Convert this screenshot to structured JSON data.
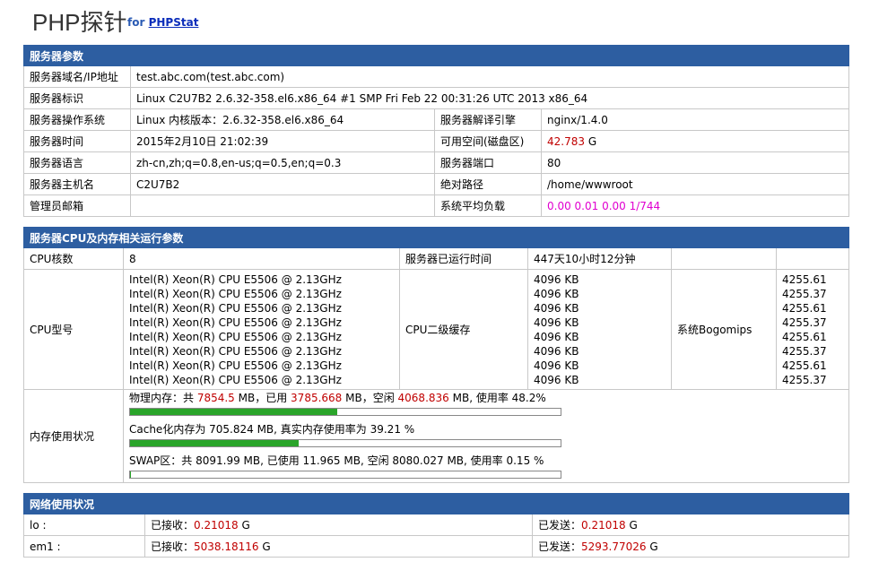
{
  "header": {
    "title": "PHP探针",
    "for_label": "for",
    "link": "PHPStat"
  },
  "server": {
    "section": "服务器参数",
    "rows": [
      {
        "label": "服务器域名/IP地址",
        "value": "test.abc.com(test.abc.com)"
      },
      {
        "label": "服务器标识",
        "value": "Linux C2U7B2 2.6.32-358.el6.x86_64 #1 SMP Fri Feb 22 00:31:26 UTC 2013 x86_64"
      },
      {
        "label": "服务器操作系统",
        "value": "Linux  内核版本：2.6.32-358.el6.x86_64",
        "label2": "服务器解译引擎",
        "value2": "nginx/1.4.0"
      },
      {
        "label": "服务器时间",
        "value": "2015年2月10日 21:02:39",
        "label2": "可用空间(磁盘区)",
        "value2_num": "42.783",
        "value2_unit": "G"
      },
      {
        "label": "服务器语言",
        "value": "zh-cn,zh;q=0.8,en-us;q=0.5,en;q=0.3",
        "label2": "服务器端口",
        "value2": "80"
      },
      {
        "label": "服务器主机名",
        "value": "C2U7B2",
        "label2": "绝对路径",
        "value2": "/home/wwwroot"
      },
      {
        "label": "管理员邮箱",
        "value": "",
        "label2": "系统平均负载",
        "value2": "0.00 0.01 0.00 1/744"
      }
    ]
  },
  "cpu": {
    "section": "服务器CPU及内存相关运行参数",
    "cores_label": "CPU核数",
    "cores_value": "8",
    "uptime_label": "服务器已运行时间",
    "uptime_value": "447天10小时12分钟",
    "model_label": "CPU型号",
    "models": [
      "Intel(R) Xeon(R) CPU E5506 @ 2.13GHz",
      "Intel(R) Xeon(R) CPU E5506 @ 2.13GHz",
      "Intel(R) Xeon(R) CPU E5506 @ 2.13GHz",
      "Intel(R) Xeon(R) CPU E5506 @ 2.13GHz",
      "Intel(R) Xeon(R) CPU E5506 @ 2.13GHz",
      "Intel(R) Xeon(R) CPU E5506 @ 2.13GHz",
      "Intel(R) Xeon(R) CPU E5506 @ 2.13GHz",
      "Intel(R) Xeon(R) CPU E5506 @ 2.13GHz"
    ],
    "cache_label": "CPU二级缓存",
    "caches": [
      "4096 KB",
      "4096 KB",
      "4096 KB",
      "4096 KB",
      "4096 KB",
      "4096 KB",
      "4096 KB",
      "4096 KB"
    ],
    "bogo_label": "系统Bogomips",
    "bogos": [
      "4255.61",
      "4255.37",
      "4255.61",
      "4255.37",
      "4255.61",
      "4255.37",
      "4255.61",
      "4255.37"
    ],
    "mem_label": "内存使用状况",
    "phys": {
      "prefix": "物理内存：共 ",
      "total": "7854.5",
      "mid1": " MB，已用 ",
      "used": "3785.668",
      "mid2": " MB，空闲 ",
      "free": "4068.836",
      "suffix": " MB, 使用率 48.2%",
      "usage": 48.2
    },
    "cache": {
      "text": "Cache化内存为 705.824 MB, 真实内存使用率为 39.21 %",
      "usage": 39.21
    },
    "swap": {
      "text": "SWAP区：共 8091.99 MB, 已使用 11.965 MB, 空闲 8080.027 MB, 使用率 0.15 %",
      "usage": 0.15
    }
  },
  "network": {
    "section": "网络使用状况",
    "rows": [
      {
        "iface": "lo :",
        "rx_label": "已接收：",
        "rx": "0.21018",
        "rx_unit": " G",
        "tx_label": "已发送：",
        "tx": "0.21018",
        "tx_unit": " G"
      },
      {
        "iface": "em1 :",
        "rx_label": "已接收：",
        "rx": "5038.18116",
        "rx_unit": " G",
        "tx_label": "已发送：",
        "tx": "5293.77026",
        "tx_unit": " G"
      }
    ]
  }
}
